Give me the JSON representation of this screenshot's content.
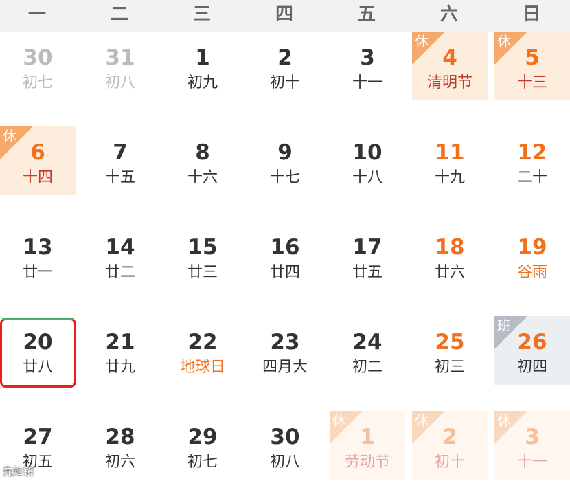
{
  "weekdays": [
    "一",
    "二",
    "三",
    "四",
    "五",
    "六",
    "日"
  ],
  "weeks": [
    [
      {
        "day": "30",
        "lunar": "初七",
        "kind": "other"
      },
      {
        "day": "31",
        "lunar": "初八",
        "kind": "other"
      },
      {
        "day": "1",
        "lunar": "初九",
        "kind": "normal"
      },
      {
        "day": "2",
        "lunar": "初十",
        "kind": "normal"
      },
      {
        "day": "3",
        "lunar": "十一",
        "kind": "normal"
      },
      {
        "day": "4",
        "lunar": "清明节",
        "kind": "holiday",
        "badge": "休",
        "festival": true
      },
      {
        "day": "5",
        "lunar": "十三",
        "kind": "holiday",
        "badge": "休"
      }
    ],
    [
      {
        "day": "6",
        "lunar": "十四",
        "kind": "holiday",
        "badge": "休"
      },
      {
        "day": "7",
        "lunar": "十五",
        "kind": "normal"
      },
      {
        "day": "8",
        "lunar": "十六",
        "kind": "normal"
      },
      {
        "day": "9",
        "lunar": "十七",
        "kind": "normal"
      },
      {
        "day": "10",
        "lunar": "十八",
        "kind": "normal"
      },
      {
        "day": "11",
        "lunar": "十九",
        "kind": "weekend"
      },
      {
        "day": "12",
        "lunar": "二十",
        "kind": "weekend"
      }
    ],
    [
      {
        "day": "13",
        "lunar": "廿一",
        "kind": "normal"
      },
      {
        "day": "14",
        "lunar": "廿二",
        "kind": "normal"
      },
      {
        "day": "15",
        "lunar": "廿三",
        "kind": "normal"
      },
      {
        "day": "16",
        "lunar": "廿四",
        "kind": "normal"
      },
      {
        "day": "17",
        "lunar": "廿五",
        "kind": "normal"
      },
      {
        "day": "18",
        "lunar": "廿六",
        "kind": "weekend"
      },
      {
        "day": "19",
        "lunar": "谷雨",
        "kind": "weekend",
        "festival": true
      }
    ],
    [
      {
        "day": "20",
        "lunar": "廿八",
        "kind": "normal",
        "selected": true
      },
      {
        "day": "21",
        "lunar": "廿九",
        "kind": "normal"
      },
      {
        "day": "22",
        "lunar": "地球日",
        "kind": "normal",
        "festival": true
      },
      {
        "day": "23",
        "lunar": "四月大",
        "kind": "normal"
      },
      {
        "day": "24",
        "lunar": "初二",
        "kind": "normal"
      },
      {
        "day": "25",
        "lunar": "初三",
        "kind": "weekend"
      },
      {
        "day": "26",
        "lunar": "初四",
        "kind": "work",
        "badge": "班"
      }
    ],
    [
      {
        "day": "27",
        "lunar": "初五",
        "kind": "normal"
      },
      {
        "day": "28",
        "lunar": "初六",
        "kind": "normal"
      },
      {
        "day": "29",
        "lunar": "初七",
        "kind": "normal"
      },
      {
        "day": "30",
        "lunar": "初八",
        "kind": "normal"
      },
      {
        "day": "1",
        "lunar": "劳动节",
        "kind": "holiday",
        "badge": "休",
        "festival": true,
        "faded": true
      },
      {
        "day": "2",
        "lunar": "初十",
        "kind": "holiday",
        "badge": "休",
        "faded": true
      },
      {
        "day": "3",
        "lunar": "十一",
        "kind": "holiday",
        "badge": "休",
        "faded": true
      }
    ]
  ],
  "watermark": "先知镜"
}
